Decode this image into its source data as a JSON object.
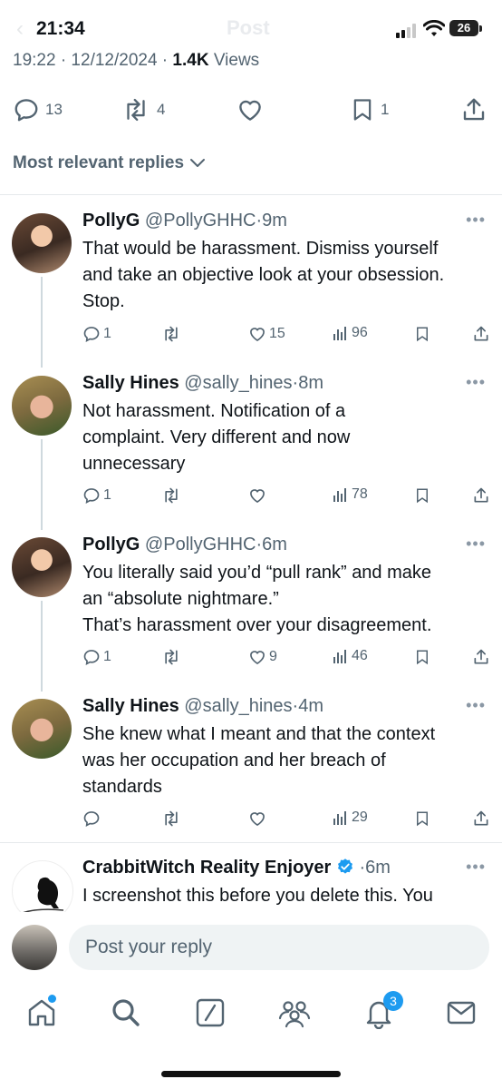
{
  "status_bar": {
    "time": "21:34",
    "title_ghost": "Post",
    "battery": "26"
  },
  "post_meta": {
    "date": "19:22 · 12/12/2024 · ",
    "views_count": "1.4K",
    "views_label": " Views"
  },
  "post_actions": {
    "replies": "13",
    "reposts": "4",
    "bookmarks": "1"
  },
  "sort": {
    "label": "Most relevant replies"
  },
  "replies": [
    {
      "name": "PollyG",
      "handle": "@PollyGHHC",
      "time": "·9m",
      "lines": [
        "That would be harassment. Dismiss yourself",
        "and take an objective look at your obsession.",
        "Stop."
      ],
      "replies": "1",
      "likes": "15",
      "views": "96"
    },
    {
      "name": "Sally Hines",
      "handle": "@sally_hines",
      "time": "·8m",
      "lines": [
        "Not harassment. Notification of a",
        "complaint. Very different and now",
        "unnecessary"
      ],
      "replies": "1",
      "likes": "",
      "views": "78"
    },
    {
      "name": "PollyG",
      "handle": "@PollyGHHC",
      "time": "·6m",
      "lines": [
        "You literally said you’d “pull rank” and make",
        "an “absolute nightmare.”",
        "That’s harassment over your disagreement."
      ],
      "replies": "1",
      "likes": "9",
      "views": "46"
    },
    {
      "name": "Sally Hines",
      "handle": "@sally_hines",
      "time": "·4m",
      "lines": [
        "She knew what I meant and that the context",
        "was her occupation and her breach of",
        "standards"
      ],
      "replies": "",
      "likes": "",
      "views": "29"
    },
    {
      "name": "CrabbitWitch Reality Enjoyer",
      "handle": "",
      "time": "·6m",
      "lines": [
        "I screenshot this before you delete this. You"
      ]
    }
  ],
  "compose": {
    "placeholder": "Post your reply"
  },
  "tabbar": {
    "notifications_badge": "3"
  },
  "colors": {
    "accent": "#1d9bf0",
    "muted": "#536471",
    "text": "#0f1419"
  }
}
